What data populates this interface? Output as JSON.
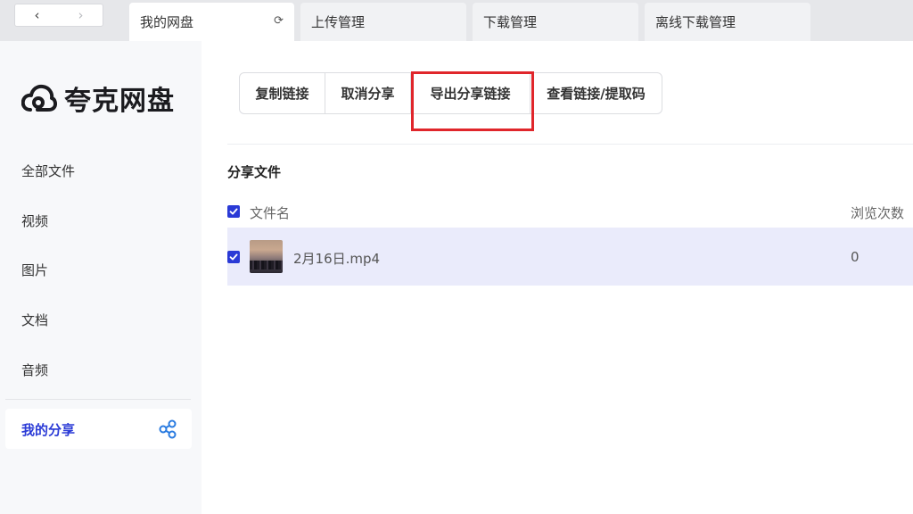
{
  "nav": {
    "back_glyph": "‹",
    "forward_glyph": "›"
  },
  "tabs": [
    {
      "label": "我的网盘",
      "active": true,
      "refresh_glyph": "⟳"
    },
    {
      "label": "上传管理",
      "active": false
    },
    {
      "label": "下载管理",
      "active": false
    },
    {
      "label": "离线下载管理",
      "active": false
    }
  ],
  "sidebar": {
    "logo_text": "夸克网盘",
    "items": [
      {
        "label": "全部文件"
      },
      {
        "label": "视频"
      },
      {
        "label": "图片"
      },
      {
        "label": "文档"
      },
      {
        "label": "音频"
      }
    ],
    "active_item": {
      "label": "我的分享",
      "icon": "share-icon"
    }
  },
  "toolbar": {
    "copy_link": "复制链接",
    "cancel_share": "取消分享",
    "export_share_link": "导出分享链接",
    "view_link_code": "查看链接/提取码"
  },
  "section": {
    "title": "分享文件"
  },
  "table": {
    "columns": {
      "name": "文件名",
      "views": "浏览次数"
    },
    "rows": [
      {
        "name": "2月16日.mp4",
        "views": "0",
        "checked": true
      }
    ]
  },
  "colors": {
    "accent": "#2a3ad6",
    "highlight_box": "#e0262b",
    "selected_row": "#eaebfb"
  }
}
